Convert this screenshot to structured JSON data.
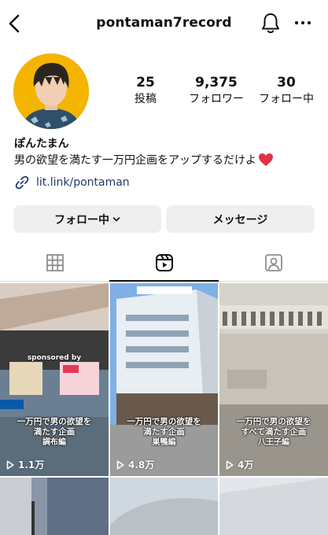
{
  "header": {
    "username": "pontaman7record",
    "back_icon": "chevron-left-icon",
    "bell_icon": "bell-icon",
    "more_icon": "more-horizontal-icon"
  },
  "profile": {
    "stats": [
      {
        "value": "25",
        "label": "投稿"
      },
      {
        "value": "9,375",
        "label": "フォロワー"
      },
      {
        "value": "30",
        "label": "フォロー中"
      }
    ],
    "display_name": "ぽんたまん",
    "bio": "男の欲望を満たす一万円企画をアップするだけよ",
    "link": "lit.link/pontaman"
  },
  "actions": {
    "follow_label": "フォロー中",
    "message_label": "メッセージ"
  },
  "tabs": [
    {
      "icon": "grid-icon",
      "active": false
    },
    {
      "icon": "reels-icon",
      "active": true
    },
    {
      "icon": "tagged-icon",
      "active": false
    }
  ],
  "reels": [
    {
      "caption_line1": "一万円で男の欲望を",
      "caption_line2": "満たす企画",
      "caption_sub": "調布編",
      "views": "1.1万",
      "overlay": "sponsored by"
    },
    {
      "caption_line1": "一万円で男の欲望を",
      "caption_line2": "満たす企画",
      "caption_sub": "巣鴨編",
      "views": "4.8万"
    },
    {
      "caption_line1": "一万円で男の欲望を",
      "caption_line2": "すべて満たす企画",
      "caption_sub": "八王子編",
      "views": "4万"
    }
  ],
  "colors": {
    "button_bg": "#efefef",
    "link": "#1f3a6b",
    "heart": "#e0334a",
    "avatar_bg": "#f4b400"
  }
}
